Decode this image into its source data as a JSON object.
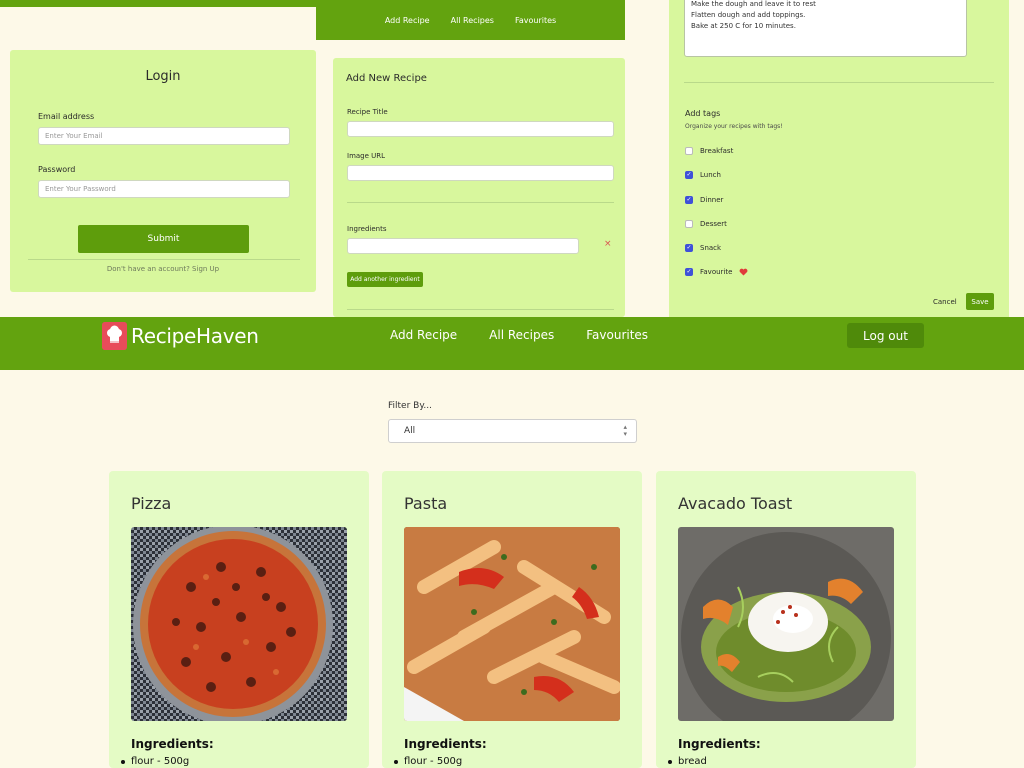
{
  "mini_nav": {
    "add_recipe": "Add Recipe",
    "all_recipes": "All Recipes",
    "favourites": "Favourites"
  },
  "login": {
    "title": "Login",
    "email_label": "Email address",
    "email_placeholder": "Enter Your Email",
    "password_label": "Password",
    "password_placeholder": "Enter Your Password",
    "submit_label": "Submit",
    "signup_text": "Don't have an account? Sign Up"
  },
  "add_form": {
    "title": "Add New Recipe",
    "recipe_title_label": "Recipe Title",
    "image_url_label": "Image URL",
    "ingredients_label": "Ingredients",
    "remove_icon": "×",
    "add_ingredient_label": "Add another ingredient"
  },
  "tags_panel": {
    "instructions_lines": [
      "Make the dough and leave it to rest",
      "Flatten dough and add toppings.",
      "Bake at 250 C for 10 minutes."
    ],
    "tags_title": "Add tags",
    "tags_subtitle": "Organize your recipes with tags!",
    "tags": [
      {
        "label": "Breakfast",
        "checked": false
      },
      {
        "label": "Lunch",
        "checked": true
      },
      {
        "label": "Dinner",
        "checked": true
      },
      {
        "label": "Dessert",
        "checked": false
      },
      {
        "label": "Snack",
        "checked": true
      },
      {
        "label": "Favourite",
        "checked": true
      }
    ],
    "cancel_label": "Cancel",
    "save_label": "Save"
  },
  "navbar": {
    "brand": "RecipeHaven",
    "links": [
      "Add Recipe",
      "All Recipes",
      "Favourites"
    ],
    "logout_label": "Log out"
  },
  "filter": {
    "label": "Filter By...",
    "selected": "All"
  },
  "recipes": [
    {
      "title": "Pizza",
      "ingredients_heading": "Ingredients:",
      "first_ingredient": "flour - 500g"
    },
    {
      "title": "Pasta",
      "ingredients_heading": "Ingredients:",
      "first_ingredient": "flour - 500g"
    },
    {
      "title": "Avacado Toast",
      "ingredients_heading": "Ingredients:",
      "first_ingredient": "bread"
    }
  ],
  "colors": {
    "brand_green": "#63a30f",
    "card_green": "#d8f79d",
    "recipe_card": "#e4fbc5",
    "page_bg": "#fdf9e8",
    "logo_red": "#e84c5a"
  }
}
